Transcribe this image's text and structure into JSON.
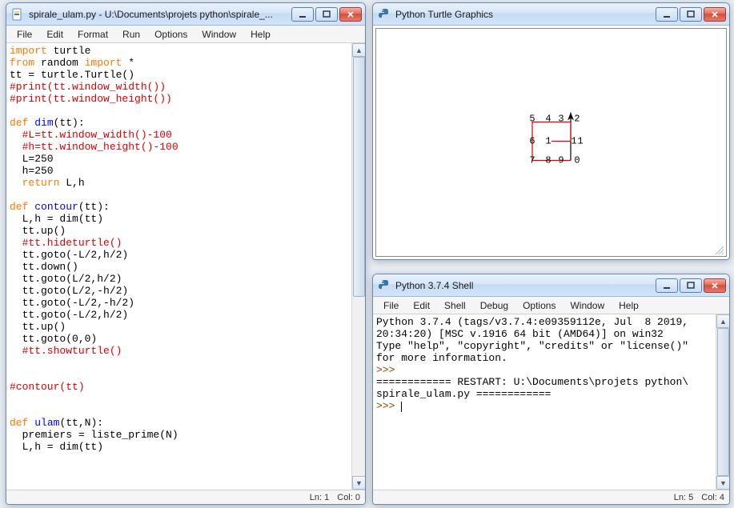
{
  "editor": {
    "title": "spirale_ulam.py - U:\\Documents\\projets python\\spirale_...",
    "menus": [
      "File",
      "Edit",
      "Format",
      "Run",
      "Options",
      "Window",
      "Help"
    ],
    "status_ln": "Ln: 1",
    "status_col": "Col: 0",
    "code": [
      [
        [
          "import ",
          "kw-orange"
        ],
        [
          "turtle",
          "kw-black"
        ]
      ],
      [
        [
          "from ",
          "kw-orange"
        ],
        [
          "random ",
          "kw-black"
        ],
        [
          "import ",
          "kw-orange"
        ],
        [
          "*",
          "kw-black"
        ]
      ],
      [
        [
          "tt = turtle.Turtle()",
          "kw-black"
        ]
      ],
      [
        [
          "#print(tt.window_width())",
          "kw-red"
        ]
      ],
      [
        [
          "#print(tt.window_height())",
          "kw-red"
        ]
      ],
      [
        [
          "",
          "kw-black"
        ]
      ],
      [
        [
          "def ",
          "kw-orange"
        ],
        [
          "dim",
          "kw-blue"
        ],
        [
          "(tt):",
          "kw-black"
        ]
      ],
      [
        [
          "  #L=tt.window_width()-100",
          "kw-red"
        ]
      ],
      [
        [
          "  #h=tt.window_height()-100",
          "kw-red"
        ]
      ],
      [
        [
          "  L=250",
          "kw-black"
        ]
      ],
      [
        [
          "  h=250",
          "kw-black"
        ]
      ],
      [
        [
          "  ",
          "kw-black"
        ],
        [
          "return ",
          "kw-orange"
        ],
        [
          "L,h",
          "kw-black"
        ]
      ],
      [
        [
          "",
          "kw-black"
        ]
      ],
      [
        [
          "def ",
          "kw-orange"
        ],
        [
          "contour",
          "kw-blue"
        ],
        [
          "(tt):",
          "kw-black"
        ]
      ],
      [
        [
          "  L,h = dim(tt)",
          "kw-black"
        ]
      ],
      [
        [
          "  tt.up()",
          "kw-black"
        ]
      ],
      [
        [
          "  #tt.hideturtle()",
          "kw-red"
        ]
      ],
      [
        [
          "  tt.goto(-L/2,h/2)",
          "kw-black"
        ]
      ],
      [
        [
          "  tt.down()",
          "kw-black"
        ]
      ],
      [
        [
          "  tt.goto(L/2,h/2)",
          "kw-black"
        ]
      ],
      [
        [
          "  tt.goto(L/2,-h/2)",
          "kw-black"
        ]
      ],
      [
        [
          "  tt.goto(-L/2,-h/2)",
          "kw-black"
        ]
      ],
      [
        [
          "  tt.goto(-L/2,h/2)",
          "kw-black"
        ]
      ],
      [
        [
          "  tt.up()",
          "kw-black"
        ]
      ],
      [
        [
          "  tt.goto(0,0)",
          "kw-black"
        ]
      ],
      [
        [
          "  #tt.showturtle()",
          "kw-red"
        ]
      ],
      [
        [
          "",
          "kw-black"
        ]
      ],
      [
        [
          "",
          "kw-black"
        ]
      ],
      [
        [
          "#contour(tt)",
          "kw-red"
        ]
      ],
      [
        [
          "",
          "kw-black"
        ]
      ],
      [
        [
          "",
          "kw-black"
        ]
      ],
      [
        [
          "def ",
          "kw-orange"
        ],
        [
          "ulam",
          "kw-blue"
        ],
        [
          "(tt,N):",
          "kw-black"
        ]
      ],
      [
        [
          "  premiers = liste_prime(N)",
          "kw-black"
        ]
      ],
      [
        [
          "  L,h = dim(tt)",
          "kw-black"
        ]
      ]
    ]
  },
  "turtle": {
    "title": "Python Turtle Graphics",
    "numbers": {
      "r0c0": "5",
      "r0c1": "4",
      "r0c2": "3",
      "r0c3": "2",
      "r1c0": "6",
      "r1c1": "1",
      "r1c3": "1",
      "r1c4": "1",
      "r2c0": "7",
      "r2c1": "8",
      "r2c2": "9",
      "r2c3": "0"
    }
  },
  "shell": {
    "title": "Python 3.7.4 Shell",
    "menus": [
      "File",
      "Edit",
      "Shell",
      "Debug",
      "Options",
      "Window",
      "Help"
    ],
    "line1": "Python 3.7.4 (tags/v3.7.4:e09359112e, Jul  8 2019,",
    "line2": "20:34:20) [MSC v.1916 64 bit (AMD64)] on win32",
    "line3": "Type \"help\", \"copyright\", \"credits\" or \"license()\"",
    "line4": "for more information.",
    "prompt1": ">>> ",
    "restart": "============ RESTART: U:\\Documents\\projets python\\",
    "restart2": "spirale_ulam.py ============",
    "prompt2": ">>> ",
    "status_ln": "Ln: 5",
    "status_col": "Col: 4"
  }
}
